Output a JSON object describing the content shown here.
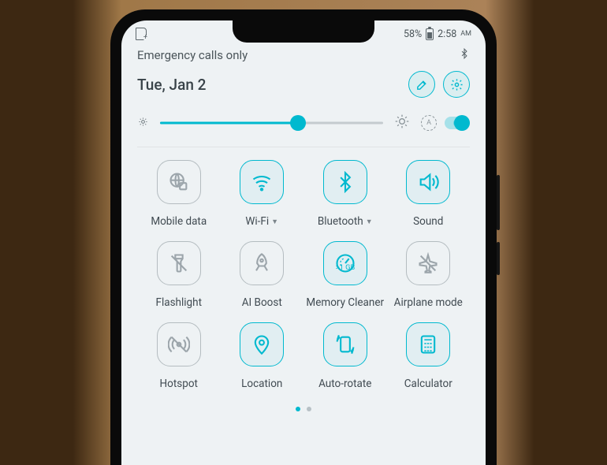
{
  "status": {
    "battery_pct": "58%",
    "time": "2:58",
    "ampm": "AM"
  },
  "carrier_text": "Emergency calls only",
  "date": "Tue, Jan 2",
  "brightness": {
    "value": 62,
    "auto": true
  },
  "tiles": [
    {
      "name": "mobile-data",
      "label": "Mobile data",
      "state": "off",
      "expandable": false,
      "icon": "globe"
    },
    {
      "name": "wifi",
      "label": "Wi-Fi",
      "state": "on",
      "expandable": true,
      "icon": "wifi"
    },
    {
      "name": "bluetooth",
      "label": "Bluetooth",
      "state": "on",
      "expandable": true,
      "icon": "bluetooth"
    },
    {
      "name": "sound",
      "label": "Sound",
      "state": "on",
      "expandable": false,
      "icon": "sound"
    },
    {
      "name": "flashlight",
      "label": "Flashlight",
      "state": "off",
      "expandable": false,
      "icon": "flashlight"
    },
    {
      "name": "ai-boost",
      "label": "AI Boost",
      "state": "off",
      "expandable": false,
      "icon": "rocket"
    },
    {
      "name": "memory-cleaner",
      "label": "Memory Cleaner",
      "state": "on",
      "expandable": false,
      "icon": "gauge",
      "badge": ">1 GB"
    },
    {
      "name": "airplane-mode",
      "label": "Airplane mode",
      "state": "off",
      "expandable": false,
      "icon": "airplane"
    },
    {
      "name": "hotspot",
      "label": "Hotspot",
      "state": "off",
      "expandable": false,
      "icon": "hotspot"
    },
    {
      "name": "location",
      "label": "Location",
      "state": "on",
      "expandable": false,
      "icon": "pin"
    },
    {
      "name": "auto-rotate",
      "label": "Auto-rotate",
      "state": "on",
      "expandable": false,
      "icon": "rotate"
    },
    {
      "name": "calculator",
      "label": "Calculator",
      "state": "on",
      "expandable": false,
      "icon": "calculator"
    }
  ],
  "pagination": {
    "page": 0,
    "total": 2
  },
  "colors": {
    "accent": "#00b9cf",
    "muted": "#9ca5ab"
  }
}
